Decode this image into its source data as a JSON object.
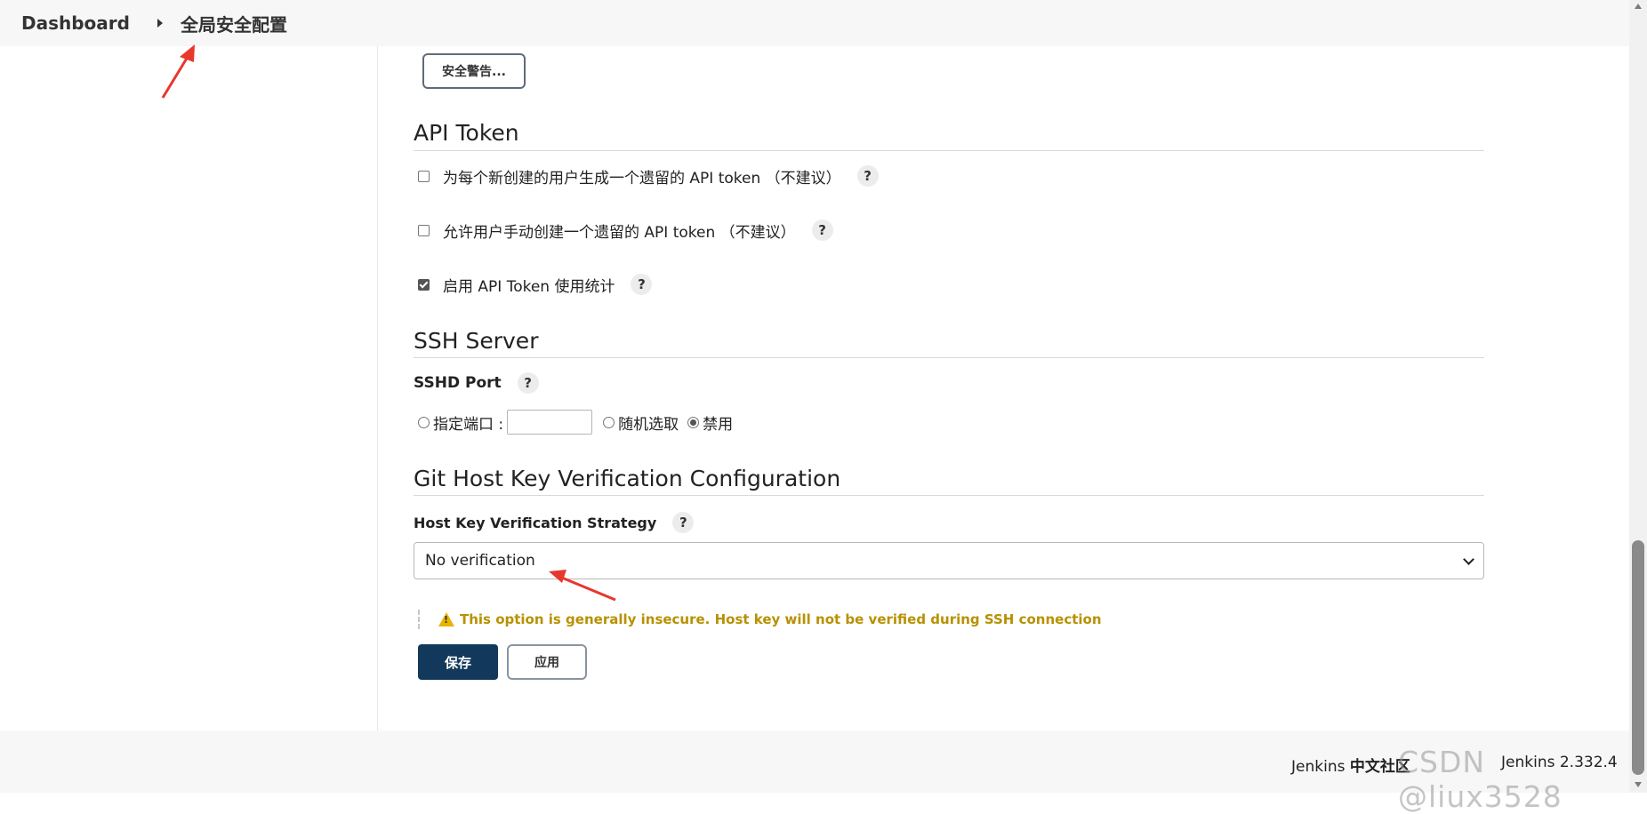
{
  "breadcrumb": {
    "root": "Dashboard",
    "current": "全局安全配置"
  },
  "security_warnings_button": "安全警告...",
  "api_token": {
    "title": "API Token",
    "options": [
      {
        "label": "为每个新创建的用户生成一个遗留的 API token （不建议）",
        "checked": false
      },
      {
        "label": "允许用户手动创建一个遗留的 API token （不建议）",
        "checked": false
      },
      {
        "label": "启用 API Token 使用统计",
        "checked": true
      }
    ]
  },
  "ssh_server": {
    "title": "SSH Server",
    "port_label": "SSHD Port",
    "radio_fixed": "指定端口 :",
    "port_value": "",
    "radio_random": "随机选取",
    "radio_disabled": "禁用",
    "selected": "禁用"
  },
  "git_host_key": {
    "title": "Git Host Key Verification Configuration",
    "strategy_label": "Host Key Verification Strategy",
    "selected": "No verification",
    "warning": "This option is generally insecure. Host key will not be verified during SSH connection"
  },
  "buttons": {
    "save": "保存",
    "apply": "应用"
  },
  "help_symbol": "?",
  "footer": {
    "community_prefix": "Jenkins ",
    "community_bold": "中文社区",
    "version": "Jenkins 2.332.4"
  },
  "watermark": "CSDN @liux3528",
  "colors": {
    "primary": "#12395b",
    "warning": "#b89100",
    "annotation": "#e8372c"
  }
}
